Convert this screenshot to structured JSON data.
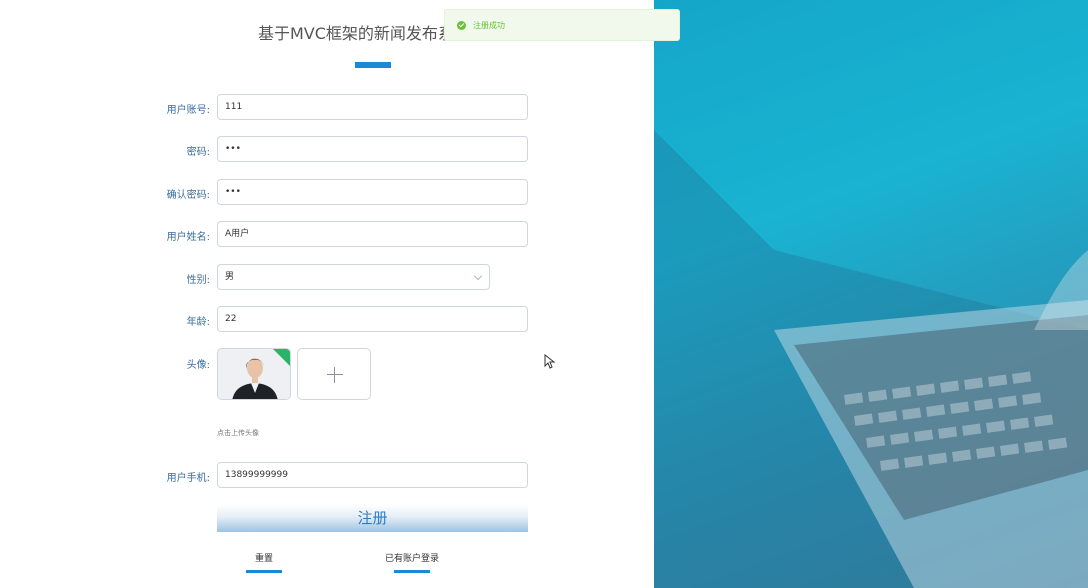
{
  "app": {
    "title": "基于MVC框架的新闻发布系统"
  },
  "toast": {
    "message": "注册成功",
    "color": "#67c23a"
  },
  "form": {
    "account": {
      "label": "用户账号:",
      "value": "111"
    },
    "password": {
      "label": "密码:",
      "value": "•••"
    },
    "confirm": {
      "label": "确认密码:",
      "value": "•••"
    },
    "name": {
      "label": "用户姓名:",
      "value": "A用户"
    },
    "gender": {
      "label": "性别:",
      "value": "男"
    },
    "age": {
      "label": "年龄:",
      "value": "22"
    },
    "avatar": {
      "label": "头像:",
      "hint": "点击上传头像"
    },
    "phone": {
      "label": "用户手机:",
      "value": "13899999999"
    }
  },
  "actions": {
    "submit": "注册",
    "reset": "重置",
    "login": "已有账户登录"
  },
  "colors": {
    "accent": "#1a8ad6",
    "label": "#3a6d9a",
    "panel": "#1ab3d2"
  }
}
